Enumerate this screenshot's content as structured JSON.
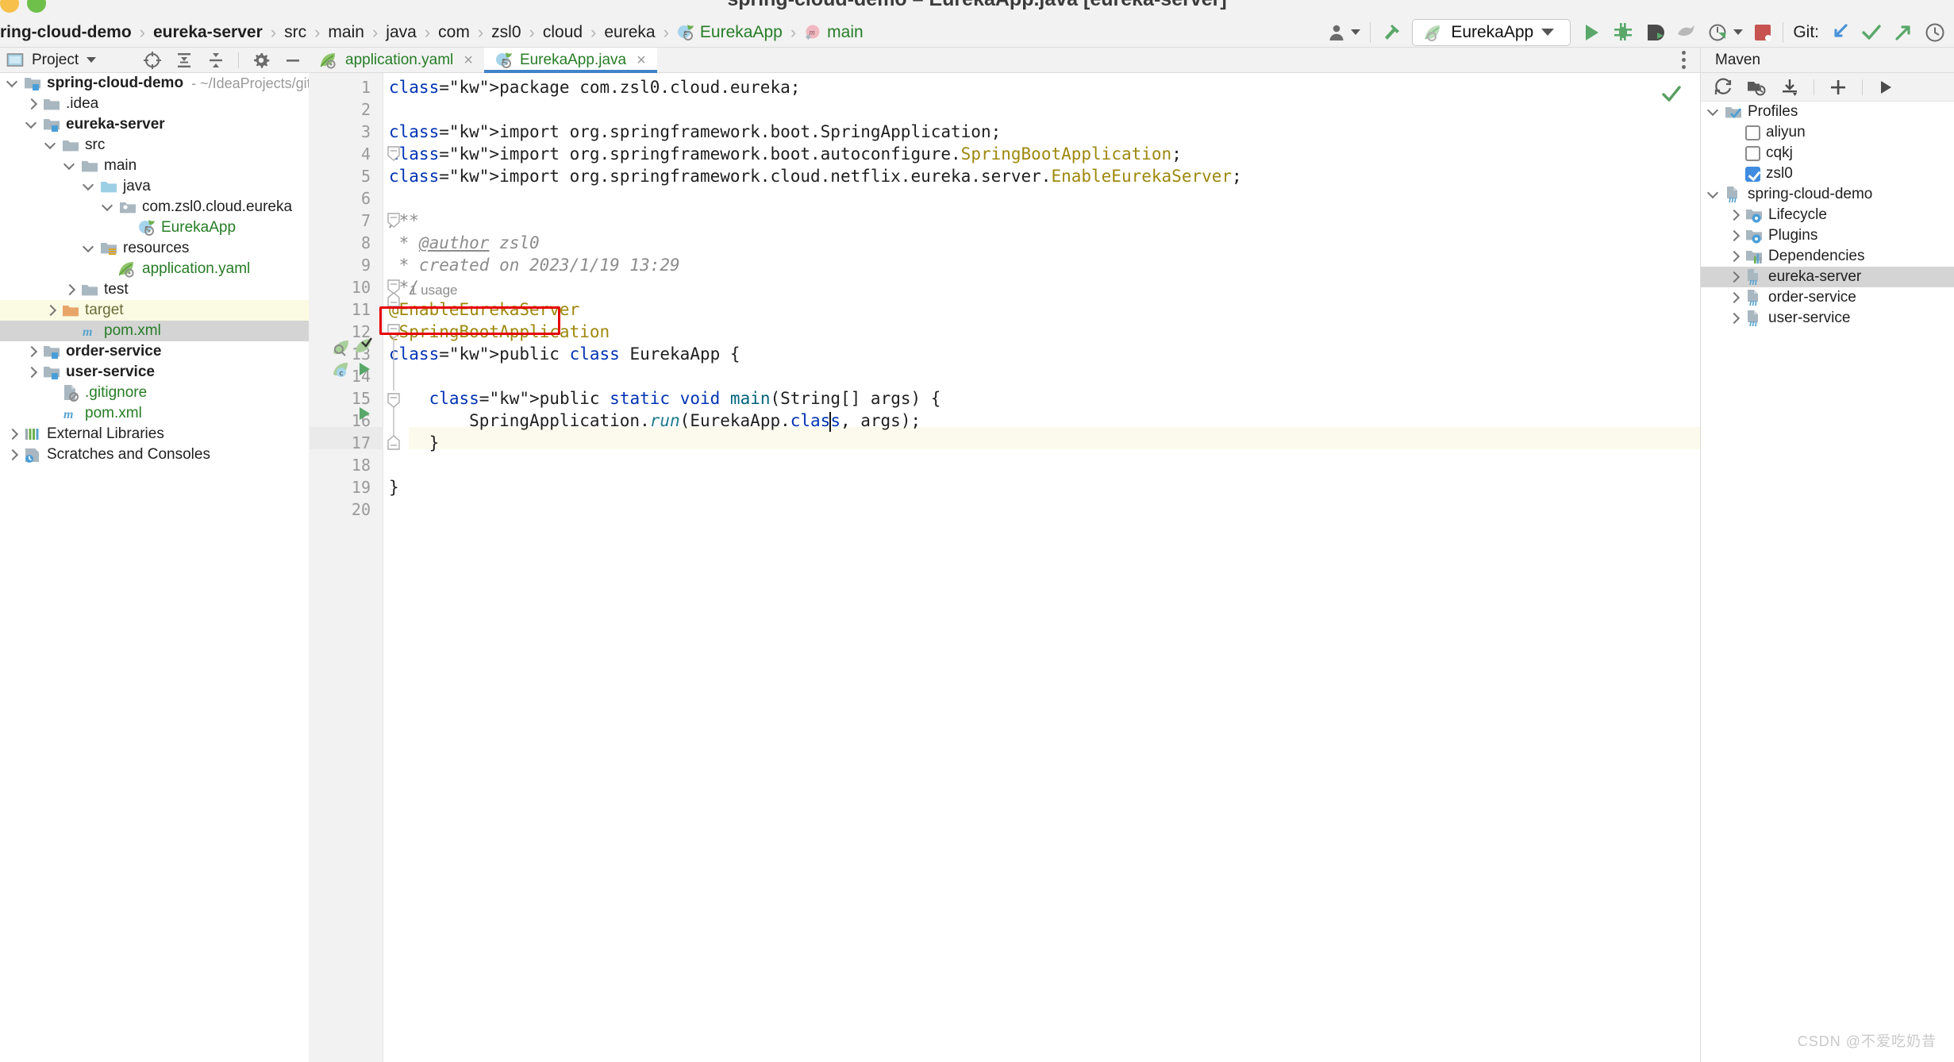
{
  "window": {
    "title": "spring-cloud-demo – EurekaApp.java [eureka-server]",
    "traffic_lights": [
      "minimize-yellow",
      "maximize-green"
    ]
  },
  "breadcrumb": {
    "items": [
      {
        "label": "ring-cloud-demo",
        "bold": true,
        "icon": "none"
      },
      {
        "label": "eureka-server",
        "bold": true,
        "icon": "none"
      },
      {
        "label": "src",
        "bold": false,
        "icon": "none"
      },
      {
        "label": "main",
        "bold": false,
        "icon": "none"
      },
      {
        "label": "java",
        "bold": false,
        "icon": "none"
      },
      {
        "label": "com",
        "bold": false,
        "icon": "none"
      },
      {
        "label": "zsl0",
        "bold": false,
        "icon": "none"
      },
      {
        "label": "cloud",
        "bold": false,
        "icon": "none"
      },
      {
        "label": "eureka",
        "bold": false,
        "icon": "none"
      },
      {
        "label": "EurekaApp",
        "bold": false,
        "icon": "class-icon"
      },
      {
        "label": "main",
        "bold": false,
        "icon": "method-icon"
      }
    ],
    "separator": "›"
  },
  "toolbar": {
    "user_icon": "user-avatar-icon",
    "build_icon": "hammer-build-icon",
    "run_config": {
      "name": "EurekaApp",
      "icon": "spring-leaf-icon",
      "dropdown": "chevron-down-icon"
    },
    "run_label": "Run",
    "debug_label": "Debug",
    "coverage_label": "Run with Coverage",
    "profiler_label": "Profiler",
    "stop_label": "Stop",
    "git_label": "Git:",
    "git_actions": [
      "update-project",
      "commit",
      "push",
      "history"
    ]
  },
  "project_panel": {
    "title": "Project",
    "dropdown": "chevron-down-icon",
    "actions": [
      "select-opened-file-icon",
      "expand-all-icon",
      "collapse-all-icon",
      "settings-gear-icon",
      "hide-minimize-icon"
    ],
    "tree": [
      {
        "label": "spring-cloud-demo",
        "detail": "- ~/IdeaProjects/gitPro",
        "depth": 0,
        "arrow": "down",
        "icon": "module-folder-icon",
        "bold": true,
        "color": "default",
        "state": "none"
      },
      {
        "label": ".idea",
        "detail": "",
        "depth": 1,
        "arrow": "right",
        "icon": "folder-icon",
        "bold": false,
        "color": "default",
        "state": "none"
      },
      {
        "label": "eureka-server",
        "detail": "",
        "depth": 1,
        "arrow": "down",
        "icon": "module-folder-icon",
        "bold": true,
        "color": "default",
        "state": "none"
      },
      {
        "label": "src",
        "detail": "",
        "depth": 2,
        "arrow": "down",
        "icon": "folder-icon",
        "bold": false,
        "color": "default",
        "state": "none"
      },
      {
        "label": "main",
        "detail": "",
        "depth": 3,
        "arrow": "down",
        "icon": "folder-icon",
        "bold": false,
        "color": "default",
        "state": "none"
      },
      {
        "label": "java",
        "detail": "",
        "depth": 4,
        "arrow": "down",
        "icon": "source-root-icon",
        "bold": false,
        "color": "default",
        "state": "none"
      },
      {
        "label": "com.zsl0.cloud.eureka",
        "detail": "",
        "depth": 5,
        "arrow": "down",
        "icon": "package-icon",
        "bold": false,
        "color": "default",
        "state": "none"
      },
      {
        "label": "EurekaApp",
        "detail": "",
        "depth": 6,
        "arrow": "none",
        "icon": "spring-class-icon",
        "bold": false,
        "color": "green",
        "state": "none"
      },
      {
        "label": "resources",
        "detail": "",
        "depth": 4,
        "arrow": "down",
        "icon": "resource-root-icon",
        "bold": false,
        "color": "default",
        "state": "none"
      },
      {
        "label": "application.yaml",
        "detail": "",
        "depth": 5,
        "arrow": "none",
        "icon": "spring-yaml-icon",
        "bold": false,
        "color": "green",
        "state": "none"
      },
      {
        "label": "test",
        "detail": "",
        "depth": 3,
        "arrow": "right",
        "icon": "folder-icon",
        "bold": false,
        "color": "default",
        "state": "none"
      },
      {
        "label": "target",
        "detail": "",
        "depth": 2,
        "arrow": "right",
        "icon": "excluded-folder-icon",
        "bold": false,
        "color": "olive",
        "state": "highlight-yellow"
      },
      {
        "label": "pom.xml",
        "detail": "",
        "depth": 3,
        "arrow": "none",
        "icon": "maven-file-icon",
        "bold": false,
        "color": "green",
        "state": "selected"
      },
      {
        "label": "order-service",
        "detail": "",
        "depth": 1,
        "arrow": "right",
        "icon": "module-folder-icon",
        "bold": true,
        "color": "default",
        "state": "none"
      },
      {
        "label": "user-service",
        "detail": "",
        "depth": 1,
        "arrow": "right",
        "icon": "module-folder-icon",
        "bold": true,
        "color": "default",
        "state": "none"
      },
      {
        "label": ".gitignore",
        "detail": "",
        "depth": 2,
        "arrow": "none",
        "icon": "gitignore-icon",
        "bold": false,
        "color": "green",
        "state": "none"
      },
      {
        "label": "pom.xml",
        "detail": "",
        "depth": 2,
        "arrow": "none",
        "icon": "maven-file-icon",
        "bold": false,
        "color": "green",
        "state": "none"
      },
      {
        "label": "External Libraries",
        "detail": "",
        "depth": 0,
        "arrow": "right",
        "icon": "libraries-icon",
        "bold": false,
        "color": "default",
        "state": "none"
      },
      {
        "label": "Scratches and Consoles",
        "detail": "",
        "depth": 0,
        "arrow": "right",
        "icon": "scratches-icon",
        "bold": false,
        "color": "default",
        "state": "none"
      }
    ]
  },
  "editor": {
    "tabs": [
      {
        "label": "application.yaml",
        "icon": "spring-yaml-icon",
        "active": false,
        "close": "×"
      },
      {
        "label": "EurekaApp.java",
        "icon": "spring-class-icon",
        "active": true,
        "close": "×"
      }
    ],
    "more_icon": "kebab-menu-icon",
    "inspection_status": "ok-check-icon",
    "current_line": 16,
    "lines": [
      {
        "num": "1",
        "text": "package com.zsl0.cloud.eureka;"
      },
      {
        "num": "2",
        "text": ""
      },
      {
        "num": "3",
        "text": "import org.springframework.boot.SpringApplication;"
      },
      {
        "num": "4",
        "text": "import org.springframework.boot.autoconfigure.SpringBootApplication;"
      },
      {
        "num": "5",
        "text": "import org.springframework.cloud.netflix.eureka.server.EnableEurekaServer;"
      },
      {
        "num": "6",
        "text": ""
      },
      {
        "num": "7",
        "text": "/**"
      },
      {
        "num": "8",
        "text": " * @author zsl0"
      },
      {
        "num": "9",
        "text": " * created on 2023/1/19 13:29"
      },
      {
        "num": "10",
        "text": " */"
      },
      {
        "num": "11",
        "text": "@EnableEurekaServer"
      },
      {
        "num": "12",
        "text": "@SpringBootApplication"
      },
      {
        "num": "13",
        "text": "public class EurekaApp {"
      },
      {
        "num": "14",
        "text": ""
      },
      {
        "num": "15",
        "text": "    public static void main(String[] args) {"
      },
      {
        "num": "16",
        "text": "        SpringApplication.run(EurekaApp.class, args);"
      },
      {
        "num": "17",
        "text": "    }"
      },
      {
        "num": "18",
        "text": ""
      },
      {
        "num": "19",
        "text": "}"
      },
      {
        "num": "20",
        "text": ""
      }
    ],
    "inlay_usage_hint": "1 usage",
    "highlight_box": {
      "target": "@EnableEurekaServer",
      "color": "#e60000"
    },
    "gutter_icons": [
      {
        "line": 12,
        "icons": [
          "spring-bean-search-icon",
          "spring-config-check-icon"
        ]
      },
      {
        "line": 13,
        "icons": [
          "spring-class-icon",
          "run-green-triangle-icon"
        ]
      },
      {
        "line": 15,
        "icons": [
          "run-green-triangle-icon"
        ]
      }
    ]
  },
  "maven_panel": {
    "title": "Maven",
    "toolbar_icons": [
      "reload-icon",
      "add-maven-project-icon",
      "download-sources-icon",
      "add-icon",
      "execute-icon"
    ],
    "tree": [
      {
        "label": "Profiles",
        "depth": 0,
        "arrow": "down",
        "icon": "profiles-folder-icon",
        "checkbox": "none",
        "state": "none"
      },
      {
        "label": "aliyun",
        "depth": 1,
        "arrow": "none",
        "icon": "none",
        "checkbox": "off",
        "state": "none"
      },
      {
        "label": "cqkj",
        "depth": 1,
        "arrow": "none",
        "icon": "none",
        "checkbox": "off",
        "state": "none"
      },
      {
        "label": "zsl0",
        "depth": 1,
        "arrow": "none",
        "icon": "none",
        "checkbox": "on",
        "state": "none"
      },
      {
        "label": "spring-cloud-demo",
        "depth": 0,
        "arrow": "down",
        "icon": "maven-project-icon",
        "checkbox": "none",
        "state": "none"
      },
      {
        "label": "Lifecycle",
        "depth": 1,
        "arrow": "right",
        "icon": "lifecycle-folder-icon",
        "checkbox": "none",
        "state": "none"
      },
      {
        "label": "Plugins",
        "depth": 1,
        "arrow": "right",
        "icon": "plugins-folder-icon",
        "checkbox": "none",
        "state": "none"
      },
      {
        "label": "Dependencies",
        "depth": 1,
        "arrow": "right",
        "icon": "dependencies-icon",
        "checkbox": "none",
        "state": "none"
      },
      {
        "label": "eureka-server",
        "depth": 1,
        "arrow": "right",
        "icon": "maven-project-icon",
        "checkbox": "none",
        "state": "selected"
      },
      {
        "label": "order-service",
        "depth": 1,
        "arrow": "right",
        "icon": "maven-project-icon",
        "checkbox": "none",
        "state": "none"
      },
      {
        "label": "user-service",
        "depth": 1,
        "arrow": "right",
        "icon": "maven-project-icon",
        "checkbox": "none",
        "state": "none"
      }
    ]
  },
  "watermark": "CSDN @不爱吃奶昔",
  "colors": {
    "accent_blue": "#4083c9",
    "green_text": "#267d26",
    "keyword_blue": "#0033b3",
    "annotation_olive": "#9e880d",
    "comment_grey": "#8c8c8c",
    "highlight_red": "#e60000",
    "selection_grey": "#d4d4d4",
    "excluded_yellow": "#fbfbe3"
  }
}
